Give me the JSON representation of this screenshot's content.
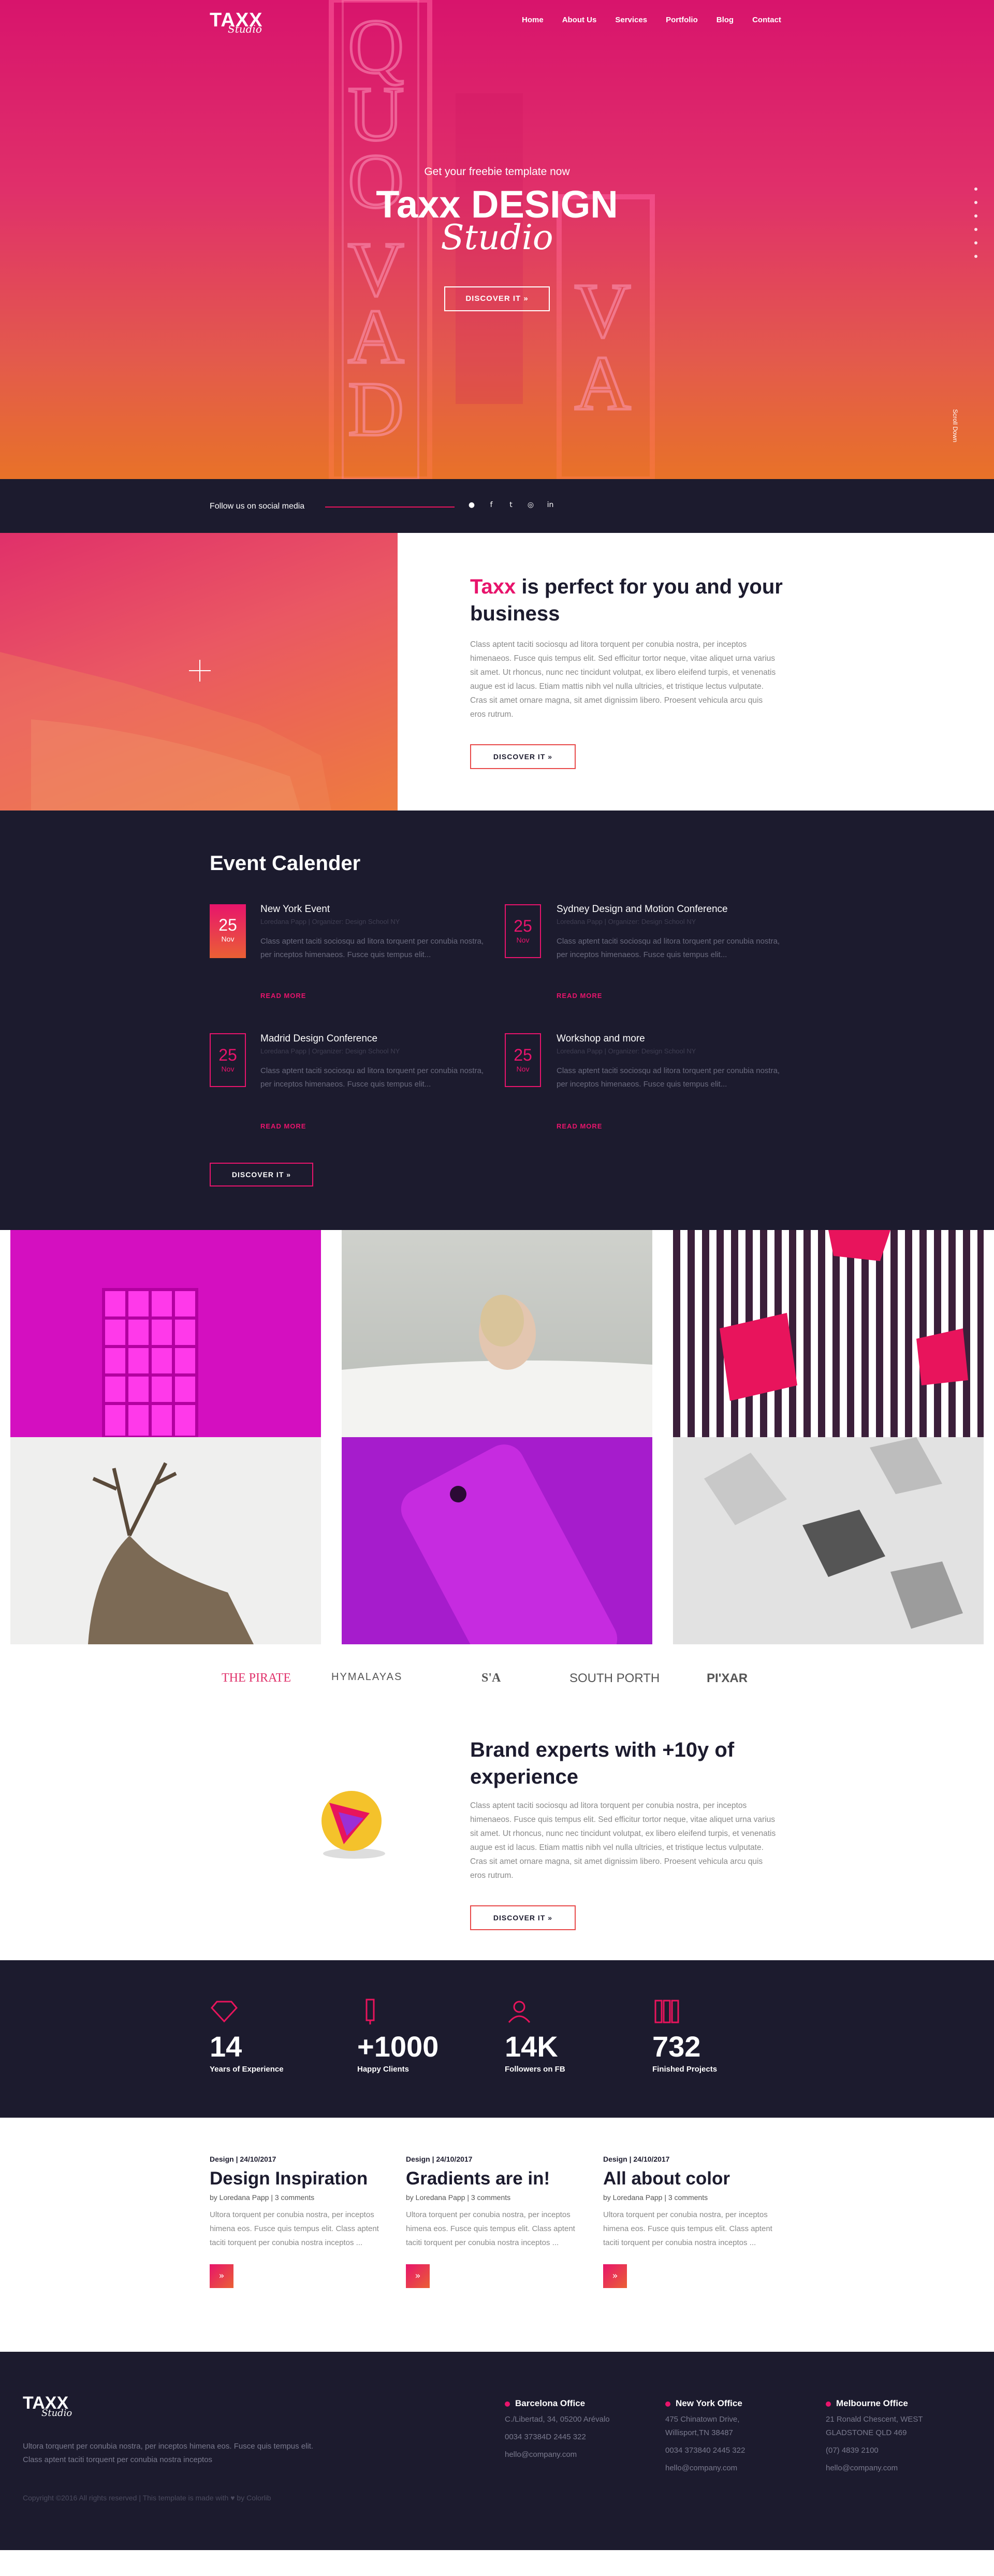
{
  "header": {
    "logo_text": "TAXX",
    "logo_script": "Studio",
    "nav": [
      "Home",
      "About Us",
      "Services",
      "Portfolio",
      "Blog",
      "Contact"
    ]
  },
  "hero": {
    "subtitle": "Get your freebie template now",
    "title": "Taxx DESIGN",
    "script": "Studio",
    "cta": "DISCOVER IT",
    "scroll_label": "Scroll Down",
    "sign_text": "QUO VADIS"
  },
  "social": {
    "label": "Follow us on social media",
    "icons": [
      "pinterest-icon",
      "facebook-icon",
      "twitter-icon",
      "instagram-icon",
      "linkedin-icon"
    ]
  },
  "about": {
    "title_accent": "Taxx",
    "title_rest": "is perfect for you and your business",
    "text": "Class aptent taciti sociosqu ad litora torquent per conubia nostra, per inceptos himenaeos. Fusce quis tempus elit. Sed efficitur tortor neque, vitae aliquet urna varius sit amet. Ut rhoncus, nunc nec tincidunt volutpat, ex libero eleifend turpis, et venenatis augue est id lacus. Etiam mattis nibh vel nulla ultricies, et tristique lectus vulputate. Cras sit amet ornare magna, sit amet dignissim libero. Proesent vehicula arcu quis eros rutrum.",
    "cta": "DISCOVER IT"
  },
  "events": {
    "title": "Event Calender",
    "items": [
      {
        "day": "25",
        "month": "Nov",
        "title": "New York Event",
        "meta": "Loredana Papp | Organizer: Design School NY",
        "text": "Class aptent taciti sociosqu ad litora torquent per conubia nostra, per inceptos himenaeos. Fusce quis tempus elit...",
        "more": "READ MORE"
      },
      {
        "day": "25",
        "month": "Nov",
        "title": "Sydney Design and Motion Conference",
        "meta": "Loredana Papp | Organizer: Design School NY",
        "text": "Class aptent taciti sociosqu ad litora torquent per conubia nostra, per inceptos himenaeos. Fusce quis tempus elit...",
        "more": "READ MORE"
      },
      {
        "day": "25",
        "month": "Nov",
        "title": "Madrid Design Conference",
        "meta": "Loredana Papp | Organizer: Design School NY",
        "text": "Class aptent taciti sociosqu ad litora torquent per conubia nostra, per inceptos himenaeos. Fusce quis tempus elit...",
        "more": "READ MORE"
      },
      {
        "day": "25",
        "month": "Nov",
        "title": "Workshop and more",
        "meta": "Loredana Papp | Organizer: Design School NY",
        "text": "Class aptent taciti sociosqu ad litora torquent per conubia nostra, per inceptos himenaeos. Fusce quis tempus elit...",
        "more": "READ MORE"
      }
    ],
    "cta": "DISCOVER IT"
  },
  "brands": {
    "items": [
      "THE PIRATE",
      "HYMALAYAS",
      "S'A",
      "SOUTH PORTH",
      "PI'XAR"
    ]
  },
  "brand": {
    "title": "Brand experts with +10y of experience",
    "text": "Class aptent taciti sociosqu ad litora torquent per conubia nostra, per inceptos himenaeos. Fusce quis tempus elit. Sed efficitur tortor neque, vitae aliquet urna varius sit amet. Ut rhoncus, nunc nec tincidunt volutpat, ex libero eleifend turpis, et venenatis augue est id lacus. Etiam mattis nibh vel nulla ultricies, et tristique lectus vulputate. Cras sit amet ornare magna, sit amet dignissim libero. Proesent vehicula arcu quis eros rutrum.",
    "cta": "DISCOVER IT"
  },
  "stats": [
    {
      "num": "14",
      "label": "Years of Experience",
      "icon": "diamond-icon"
    },
    {
      "num": "+1000",
      "label": "Happy Clients",
      "icon": "pen-icon"
    },
    {
      "num": "14K",
      "label": "Followers on FB",
      "icon": "user-icon"
    },
    {
      "num": "732",
      "label": "Finished Projects",
      "icon": "books-icon"
    }
  ],
  "blog": [
    {
      "category": "Design",
      "date": "24/10/2017",
      "title": "Design Inspiration",
      "by": "by Loredana Papp",
      "comments": "3 comments",
      "excerpt": "Ultora torquent per conubia nostra, per inceptos himena eos. Fusce quis tempus elit. Class aptent taciti torquent per conubia nostra inceptos ..."
    },
    {
      "category": "Design",
      "date": "24/10/2017",
      "title": "Gradients are in!",
      "by": "by Loredana Papp",
      "comments": "3 comments",
      "excerpt": "Ultora torquent per conubia nostra, per inceptos himena eos. Fusce quis tempus elit. Class aptent taciti torquent per conubia nostra inceptos ..."
    },
    {
      "category": "Design",
      "date": "24/10/2017",
      "title": "All about color",
      "by": "by Loredana Papp",
      "comments": "3 comments",
      "excerpt": "Ultora torquent per conubia nostra, per inceptos himena eos. Fusce quis tempus elit. Class aptent taciti torquent per conubia nostra inceptos ..."
    }
  ],
  "footer": {
    "logo_text": "TAXX",
    "logo_script": "Studio",
    "about": "Ultora torquent per conubia nostra, per inceptos himena eos. Fusce quis tempus elit. Class aptent taciti torquent per conubia nostra inceptos",
    "copyright": "Copyright ©2016 All rights reserved | This template is made with ♥ by Colorlib",
    "offices": [
      {
        "city": "Barcelona Office",
        "lines": [
          "C./Libertad, 34, 05200 Arévalo",
          "0034 37384D 2445 322",
          "hello@company.com"
        ]
      },
      {
        "city": "New York Office",
        "lines": [
          "475 Chinatown Drive, Willisport,TN 38487",
          "0034 373840 2445 322",
          "hello@company.com"
        ]
      },
      {
        "city": "Melbourne Office",
        "lines": [
          "21 Ronald Chescent, WEST GLADSTONE QLD 469",
          "(07) 4839 2100",
          "hello@company.com"
        ]
      }
    ]
  },
  "colors": {
    "accent": "#e8146c",
    "orange": "#ea6034",
    "dark": "#1c1b2e"
  }
}
